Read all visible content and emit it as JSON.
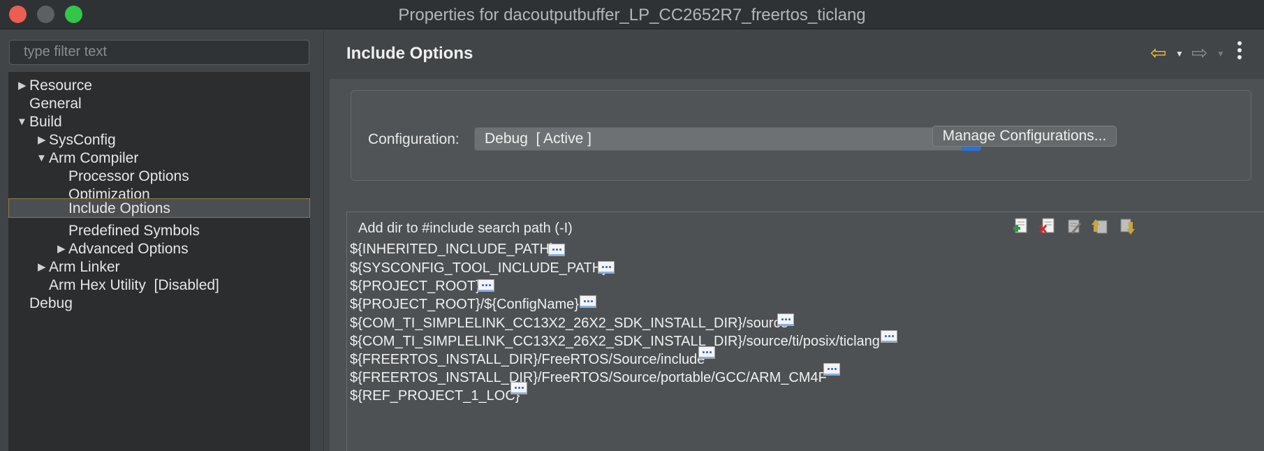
{
  "window": {
    "title": "Properties for dacoutputbuffer_LP_CC2652R7_freertos_ticlang"
  },
  "filter": {
    "placeholder": "type filter text"
  },
  "tree": {
    "items": [
      {
        "label": "Resource",
        "expanded": false,
        "has_children": true
      },
      {
        "label": "General",
        "has_children": false
      },
      {
        "label": "Build",
        "expanded": true,
        "has_children": true
      },
      {
        "label": "SysConfig",
        "expanded": false,
        "has_children": true
      },
      {
        "label": "Arm Compiler",
        "expanded": true,
        "has_children": true
      },
      {
        "label": "Processor Options",
        "has_children": false
      },
      {
        "label": "Optimization",
        "has_children": false
      },
      {
        "label": "Include Options",
        "has_children": false,
        "selected": true
      },
      {
        "label": "Predefined Symbols",
        "has_children": false
      },
      {
        "label": "Advanced Options",
        "expanded": false,
        "has_children": true
      },
      {
        "label": "Arm Linker",
        "expanded": false,
        "has_children": true
      },
      {
        "label": "Arm Hex Utility  [Disabled]",
        "has_children": false
      },
      {
        "label": "Debug",
        "has_children": false
      }
    ]
  },
  "page": {
    "title": "Include Options",
    "nav_icons": [
      "back-arrow-icon",
      "forward-arrow-icon",
      "more-vertical-icon"
    ]
  },
  "configuration": {
    "label": "Configuration:",
    "value": "Debug  [ Active ]",
    "manage_label": "Manage Configurations..."
  },
  "include_paths": {
    "title": "Add dir to #include search path (-I)",
    "toolbar": [
      "add-path-icon",
      "delete-path-icon",
      "edit-path-icon",
      "move-up-icon",
      "move-down-icon"
    ],
    "items": [
      "${INHERITED_INCLUDE_PATH}",
      "${SYSCONFIG_TOOL_INCLUDE_PATH}",
      "${PROJECT_ROOT}",
      "${PROJECT_ROOT}/${ConfigName}",
      "${COM_TI_SIMPLELINK_CC13X2_26X2_SDK_INSTALL_DIR}/source",
      "${COM_TI_SIMPLELINK_CC13X2_26X2_SDK_INSTALL_DIR}/source/ti/posix/ticlang",
      "${FREERTOS_INSTALL_DIR}/FreeRTOS/Source/include",
      "${FREERTOS_INSTALL_DIR}/FreeRTOS/Source/portable/GCC/ARM_CM4F",
      "${REF_PROJECT_1_LOC}"
    ]
  },
  "colors": {
    "accent_blue": "#2e6fd6",
    "selection_border": "#8a7b45",
    "back_arrow": "#f1c232"
  }
}
